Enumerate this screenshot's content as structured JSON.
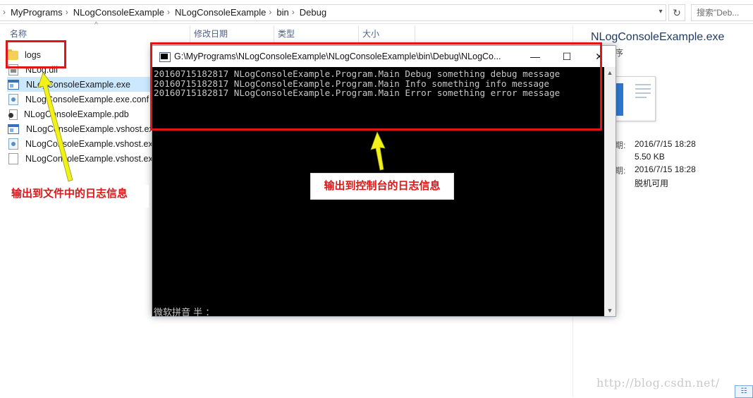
{
  "breadcrumbs": [
    "MyPrograms",
    "NLogConsoleExample",
    "NLogConsoleExample",
    "bin",
    "Debug"
  ],
  "search": {
    "placeholder": "搜索\"Deb..."
  },
  "columns": {
    "name": "名称",
    "modified": "修改日期",
    "type": "类型",
    "size": "大小"
  },
  "files": [
    {
      "name": "logs",
      "icon": "folder-icon"
    },
    {
      "name": "NLog.dll",
      "icon": "dll-file-icon"
    },
    {
      "name": "NLogConsoleExample.exe",
      "icon": "exe-file-icon",
      "selected": true
    },
    {
      "name": "NLogConsoleExample.exe.conf",
      "icon": "config-file-icon"
    },
    {
      "name": "NLogConsoleExample.pdb",
      "icon": "pdb-file-icon"
    },
    {
      "name": "NLogConsoleExample.vshost.ex",
      "icon": "exe-file-icon"
    },
    {
      "name": "NLogConsoleExample.vshost.ex",
      "icon": "config-file-icon"
    },
    {
      "name": "NLogConsoleExample.vshost.ex",
      "icon": "blank-file-icon"
    }
  ],
  "details": {
    "title": "NLogConsoleExample.exe",
    "subtitle": "序",
    "rows": [
      {
        "key": "期:",
        "value": "2016/7/15 18:28"
      },
      {
        "key": "",
        "value": "5.50 KB"
      },
      {
        "key": "期:",
        "value": "2016/7/15 18:28"
      },
      {
        "key": "",
        "value": "脱机可用"
      }
    ]
  },
  "console": {
    "title": "G:\\MyPrograms\\NLogConsoleExample\\NLogConsoleExample\\bin\\Debug\\NLogCo...",
    "lines": [
      "20160715182817 NLogConsoleExample.Program.Main Debug something debug message",
      "20160715182817 NLogConsoleExample.Program.Main Info something info message",
      "20160715182817 NLogConsoleExample.Program.Main Error something error message"
    ],
    "ime_status": "微软拼音 半 ："
  },
  "annotations": {
    "file_log_label": "输出到文件中的日志信息",
    "console_log_label": "输出到控制台的日志信息",
    "accent_color": "#e01515",
    "arrow_color": "#f2f21a"
  },
  "watermark": "http://blog.csdn.net/"
}
